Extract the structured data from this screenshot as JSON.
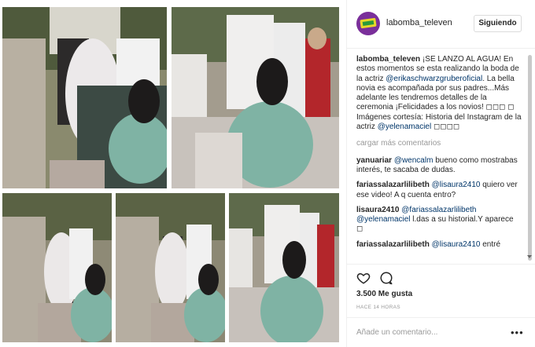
{
  "header": {
    "username": "labomba_televen",
    "follow_label": "Siguiendo"
  },
  "caption": {
    "user": "labomba_televen",
    "text1": "¡SE LANZO AL AGUA! En estos momentos se esta realizando la boda de la actriz",
    "mention1": "@erikaschwarzgruberoficial",
    "text2": ". La bella novia es acompañada por sus padres...Más adelante les tendremos detalles de la ceremonia ¡Felicidades a los novios! ◻◻◻ ◻",
    "text3": "Imágenes cortesía: Historia del Instagram de la actriz",
    "mention2": "@yelenamaciel",
    "text4": "◻◻◻◻"
  },
  "load_more_label": "cargar más comentarios",
  "comments": [
    {
      "user": "yanuariar",
      "mention": "@wencalm",
      "text": "bueno como mostrabas interés, te sacaba de dudas."
    },
    {
      "user": "fariassalazarlilibeth",
      "mention": "@lisaura2410",
      "text": "quiero ver ese video! A q cuenta entro?"
    },
    {
      "user": "lisaura2410",
      "mention": "@fariassalazarlilibeth @yelenamaciel",
      "text": "l.das a su historial.Y aparece ◻"
    },
    {
      "user": "fariassalazarlilibeth",
      "mention": "@lisaura2410",
      "text": "entré"
    }
  ],
  "likes": "3.500 Me gusta",
  "time": "HACE 14 HORAS",
  "add_comment_placeholder": "Añade un comentario...",
  "colors": {
    "link": "#003569",
    "muted": "#999999",
    "border": "#efefef",
    "avatar_bg": "#7a2f9a"
  }
}
